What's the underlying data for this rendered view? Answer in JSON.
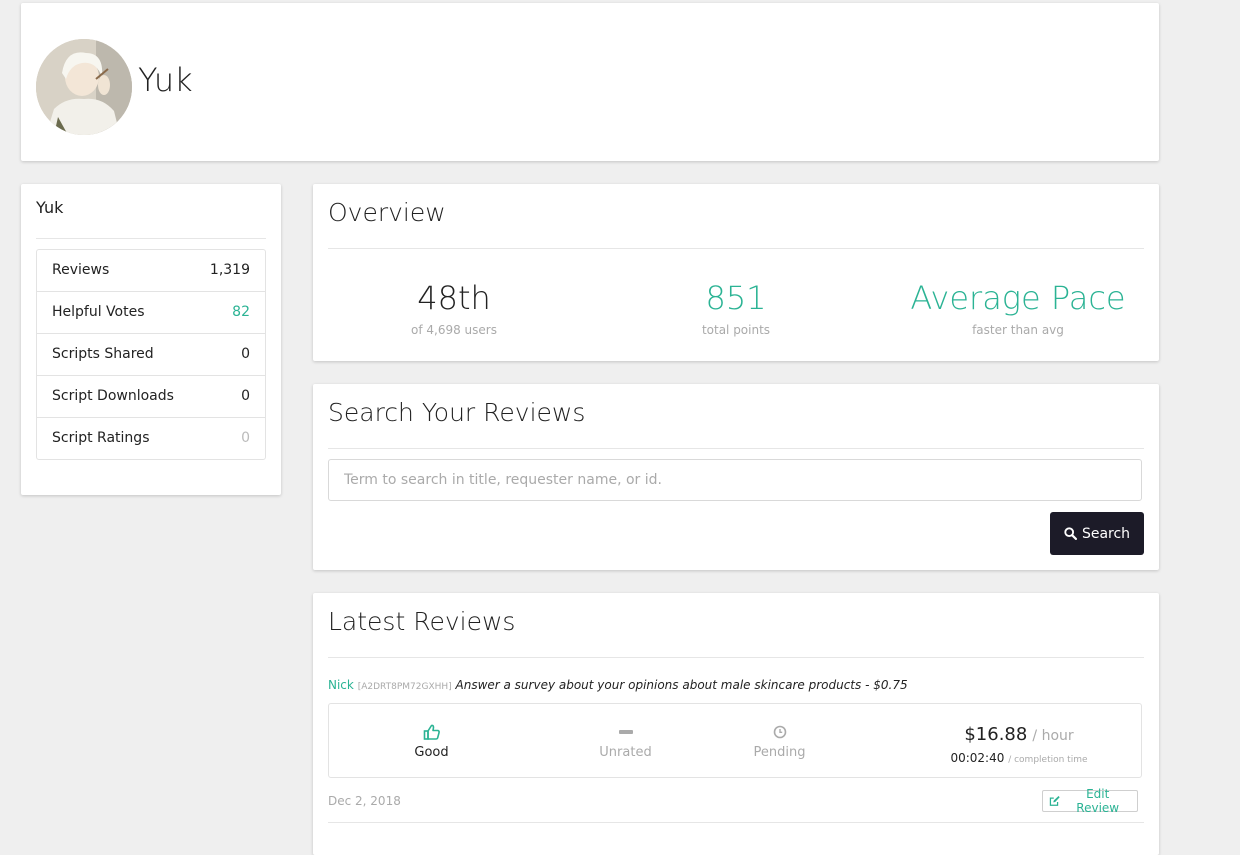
{
  "profile": {
    "name": "Yuk"
  },
  "sidebar": {
    "title": "Yuk",
    "stats": [
      {
        "label": "Reviews",
        "value": "1,319"
      },
      {
        "label": "Helpful Votes",
        "value": "82"
      },
      {
        "label": "Scripts Shared",
        "value": "0"
      },
      {
        "label": "Script Downloads",
        "value": "0"
      },
      {
        "label": "Script Ratings",
        "value": "0"
      }
    ]
  },
  "overview": {
    "title": "Overview",
    "rank": {
      "value": "48th",
      "caption": "of 4,698 users"
    },
    "points": {
      "value": "851",
      "caption": "total points"
    },
    "pace": {
      "value": "Average Pace",
      "caption": "faster than avg"
    }
  },
  "search": {
    "title": "Search Your Reviews",
    "placeholder": "Term to search in title, requester name, or id.",
    "button_label": "Search"
  },
  "reviews": {
    "title": "Latest Reviews",
    "items": [
      {
        "requester": "Nick",
        "requester_id": "[A2DRT8PM72GXHH]",
        "hit_title": "Answer a survey about your opinions about male skincare products",
        "separator": " - ",
        "reward": "$0.75",
        "ratings": [
          {
            "label": "Good",
            "icon": "thumbs-up-icon"
          },
          {
            "label": "Unrated",
            "icon": "dash-icon"
          },
          {
            "label": "Pending",
            "icon": "clock-icon"
          }
        ],
        "hourly": "$16.88",
        "hourly_unit": "/ hour",
        "completion_time": "00:02:40",
        "completion_unit": "/ completion time",
        "date": "Dec 2, 2018",
        "edit_label": "Edit Review"
      }
    ]
  },
  "colors": {
    "accent": "#2bb394",
    "button_dark": "#1c1b28",
    "page_bg": "#efefef"
  }
}
